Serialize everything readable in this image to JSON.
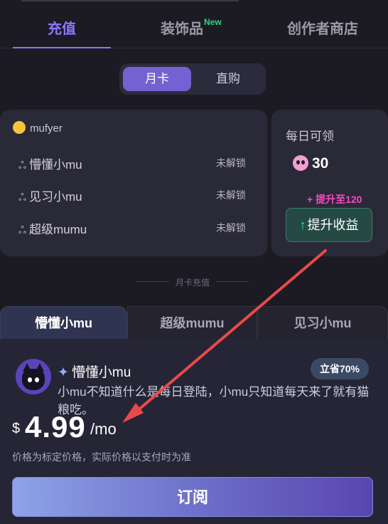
{
  "tabs": {
    "recharge": "充值",
    "decorations": "装饰品",
    "new_badge": "New",
    "creator_store": "创作者商店"
  },
  "switch": {
    "monthly": "月卡",
    "direct": "直购"
  },
  "membership": {
    "username": "mufyer",
    "tiers": [
      {
        "label": "懵懂小mu",
        "status": "未解锁"
      },
      {
        "label": "见习小mu",
        "status": "未解锁"
      },
      {
        "label": "超级mumu",
        "status": "未解锁"
      }
    ]
  },
  "daily": {
    "title": "每日可领",
    "amount": "30",
    "boost_text": "+ 提升至120",
    "boost_button": "提升收益"
  },
  "divider_text": "月卡充值",
  "plan_tabs": [
    "懵懂小mu",
    "超级mumu",
    "见习小mu"
  ],
  "plan": {
    "name": "懵懂小mu",
    "save_badge": "立省70%",
    "description": "小mu不知道什么是每日登陆，小mu只知道每天来了就有猫粮吃。",
    "currency": "$",
    "price": "4.99",
    "unit": "/mo",
    "price_note": "价格为标定价格，实际价格以支付时为准",
    "subscribe_label": "订阅"
  },
  "colors": {
    "accent": "#8f74ff",
    "boost_pink": "#ee4fc0",
    "new_green": "#31d08b",
    "arrow_red": "#e84a4a"
  }
}
